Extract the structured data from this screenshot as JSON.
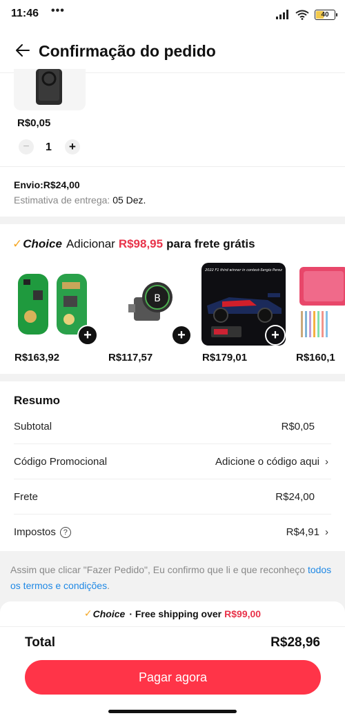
{
  "status_bar": {
    "time": "11:46",
    "dots": "•••",
    "battery": "40"
  },
  "header": {
    "title": "Confirmação do pedido"
  },
  "product": {
    "price": "R$0,05",
    "quantity": "1",
    "minus": "−",
    "plus": "+"
  },
  "shipping": {
    "label": "Envio:R$24,00",
    "eta_label": "Estimativa de entrega:",
    "eta_value": "05 Dez."
  },
  "choice_upsell": {
    "logo": "Choice",
    "prefix": "Adicionar",
    "amount": "R$98,95",
    "suffix": "para frete grátis",
    "items": [
      {
        "price": "R$163,92",
        "add": "+"
      },
      {
        "price": "R$117,57",
        "add": "+"
      },
      {
        "price": "R$179,01",
        "add": "+",
        "caption": "2022 F1 third winner in contest-Sergio Perez"
      },
      {
        "price": "R$160,1"
      }
    ]
  },
  "summary": {
    "title": "Resumo",
    "rows": [
      {
        "label": "Subtotal",
        "value": "R$0,05"
      },
      {
        "label": "Código Promocional",
        "value": "Adicione o código aqui"
      },
      {
        "label": "Frete",
        "value": "R$24,00"
      },
      {
        "label": "Impostos",
        "value": "R$4,91"
      }
    ]
  },
  "terms": {
    "text": "Assim que clicar \"Fazer Pedido\", Eu confirmo que li e que reconheço",
    "link": "todos os termos e condições",
    "end": "."
  },
  "bottom": {
    "choice_logo": "Choice",
    "free_ship_text": "· Free shipping over",
    "free_ship_amount": "R$99,00",
    "total_label": "Total",
    "total_value": "R$28,96",
    "pay_button": "Pagar agora"
  },
  "colors": {
    "accent": "#ff3448",
    "price_red": "#e8334a",
    "choice_gold": "#f5a623",
    "link": "#1e88e5"
  }
}
